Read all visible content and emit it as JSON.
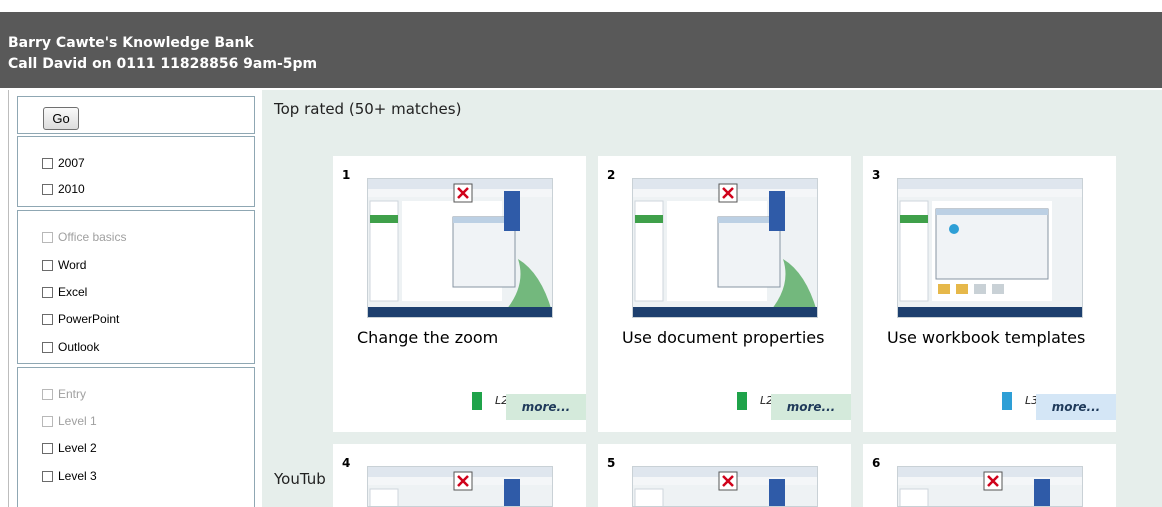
{
  "header": {
    "line1": "Barry Cawte's Knowledge Bank",
    "line2": "Call David on 0111 11828856 9am-5pm"
  },
  "sidebar": {
    "go_label": "Go",
    "versions": [
      {
        "label": "2007",
        "disabled": false
      },
      {
        "label": "2010",
        "disabled": false
      }
    ],
    "apps": [
      {
        "label": "Office basics",
        "disabled": true
      },
      {
        "label": "Word",
        "disabled": false
      },
      {
        "label": "Excel",
        "disabled": false
      },
      {
        "label": "PowerPoint",
        "disabled": false
      },
      {
        "label": "Outlook",
        "disabled": false
      }
    ],
    "levels": [
      {
        "label": "Entry",
        "disabled": true
      },
      {
        "label": "Level 1",
        "disabled": true
      },
      {
        "label": "Level 2",
        "disabled": false
      },
      {
        "label": "Level 3",
        "disabled": false
      }
    ]
  },
  "main": {
    "section_title": "Top rated (50+ matches)",
    "next_section_partial": "YouTub",
    "cards": [
      {
        "num": "1",
        "title": "Change the zoom",
        "level": "L2",
        "level_color": "#1fa34a",
        "more_bg": "#d4eadb",
        "more": "more..."
      },
      {
        "num": "2",
        "title": "Use document properties",
        "level": "L2",
        "level_color": "#1fa34a",
        "more_bg": "#d4eadb",
        "more": "more..."
      },
      {
        "num": "3",
        "title": "Use workbook templates",
        "level": "L3",
        "level_color": "#2e9fd6",
        "more_bg": "#d4e6f6",
        "more": "more..."
      },
      {
        "num": "4"
      },
      {
        "num": "5"
      },
      {
        "num": "6"
      }
    ]
  }
}
